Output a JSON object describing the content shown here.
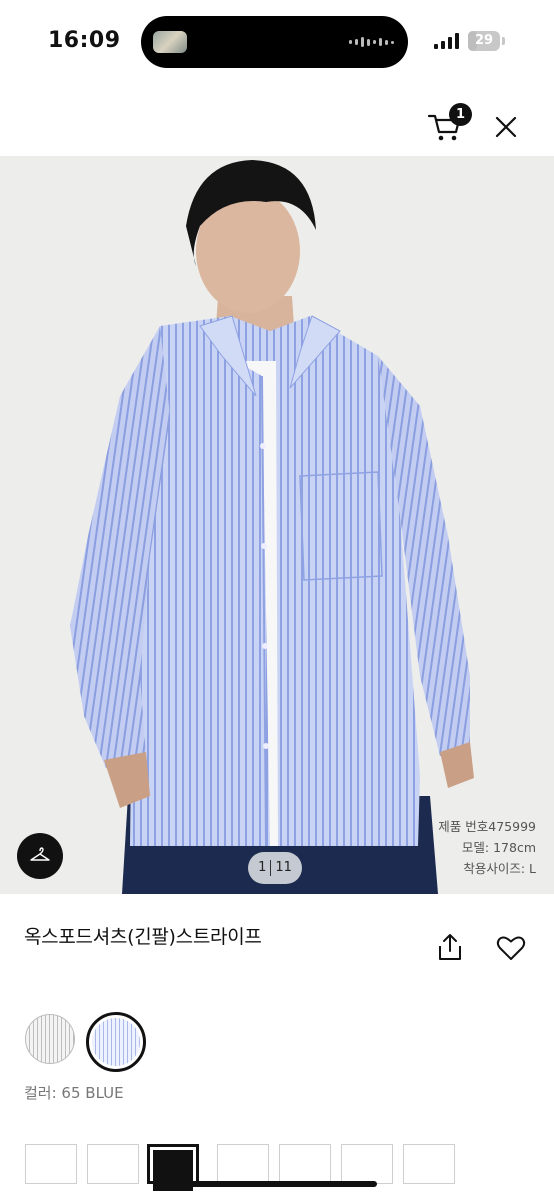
{
  "status": {
    "time": "16:09",
    "battery": "29",
    "battery_percent": 29
  },
  "header": {
    "cart_count": "1",
    "icons": [
      "cart-icon",
      "close-icon"
    ]
  },
  "gallery": {
    "model_info": [
      "제품 번호475999",
      "모델: 178cm",
      "착용사이즈: L"
    ],
    "current": "1",
    "total": "11",
    "background": "#ededeb"
  },
  "product": {
    "title": "옥스포드셔츠(긴팔)스트라이프",
    "color_label": "컬러: 65 BLUE",
    "swatches": [
      {
        "name": "gray stripe",
        "selected": false
      },
      {
        "name": "blue stripe",
        "selected": true
      }
    ],
    "sizes_visible": 7,
    "selected_size_index": 2
  },
  "colors": {
    "shirt": "#b9c6ef",
    "shirt_stripe": "#8ea2e3",
    "pants": "#1b2a4e",
    "accent": "#111111"
  }
}
